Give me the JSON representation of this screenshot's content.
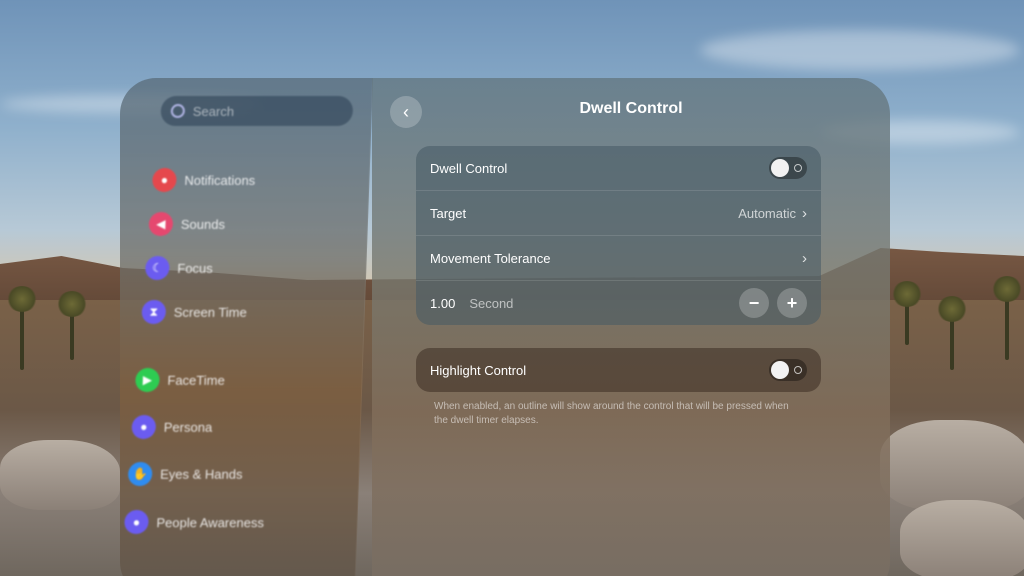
{
  "sidebar": {
    "search_placeholder": "Search",
    "items": [
      {
        "label": "Notifications",
        "icon": "bell-icon",
        "color": "#e5484d"
      },
      {
        "label": "Sounds",
        "icon": "speaker-icon",
        "color": "#e5486f"
      },
      {
        "label": "Focus",
        "icon": "moon-icon",
        "color": "#6b5cf0"
      },
      {
        "label": "Screen Time",
        "icon": "hourglass-icon",
        "color": "#6b5cf0"
      },
      {
        "label": "FaceTime",
        "icon": "video-icon",
        "color": "#2ecc52"
      },
      {
        "label": "Persona",
        "icon": "person-icon",
        "color": "#6b5cf0"
      },
      {
        "label": "Eyes & Hands",
        "icon": "hand-icon",
        "color": "#2f8cf0"
      },
      {
        "label": "People Awareness",
        "icon": "people-icon",
        "color": "#6b5cf0"
      }
    ]
  },
  "header": {
    "title": "Dwell Control",
    "back": "‹"
  },
  "dwell_group": {
    "dwell_control_label": "Dwell Control",
    "dwell_control_on": false,
    "target_label": "Target",
    "target_value": "Automatic",
    "movement_tolerance_label": "Movement Tolerance",
    "duration_value": "1.00",
    "duration_unit": "Second",
    "minus": "−",
    "plus": "+",
    "chevron": "›"
  },
  "highlight_group": {
    "label": "Highlight Control",
    "on": false,
    "footnote": "When enabled, an outline will show around the control that will be pressed when the dwell timer elapses."
  }
}
